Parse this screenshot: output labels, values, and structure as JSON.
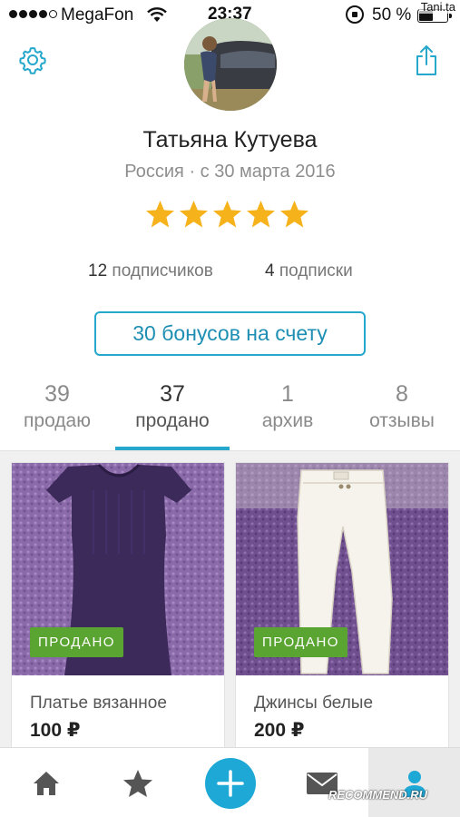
{
  "status_bar": {
    "carrier": "MegaFon",
    "time": "23:37",
    "battery_percent": "50 %",
    "battery_level": 0.5,
    "signal_bars": 4,
    "watermark": "Tani.ta"
  },
  "profile": {
    "name": "Татьяна Кутуева",
    "location": "Россия · с 30 марта 2016",
    "rating": 5,
    "followers": {
      "count": "12",
      "label": "подписчиков"
    },
    "following": {
      "count": "4",
      "label": "подписки"
    },
    "bonus_button": "30 бонусов на счету"
  },
  "icons": {
    "settings": "gear-icon",
    "share": "share-icon",
    "home": "home-icon",
    "favorites": "star-icon",
    "add": "plus-icon",
    "messages": "envelope-icon",
    "profile": "user-icon"
  },
  "tabs": [
    {
      "count": "39",
      "label": "продаю"
    },
    {
      "count": "37",
      "label": "продано"
    },
    {
      "count": "1",
      "label": "архив"
    },
    {
      "count": "8",
      "label": "отзывы"
    }
  ],
  "active_tab": 1,
  "listings": [
    {
      "title": "Платье вязанное",
      "price": "100 ₽",
      "badge": "ПРОДАНО"
    },
    {
      "title": "Джинсы белые",
      "price": "200 ₽",
      "badge": "ПРОДАНО"
    }
  ],
  "watermark_bottom": "RECOMMEND.RU",
  "colors": {
    "accent": "#26a7cc",
    "sold_badge": "#5aa532",
    "star": "#f6b21b",
    "fab": "#1ea8d6"
  }
}
